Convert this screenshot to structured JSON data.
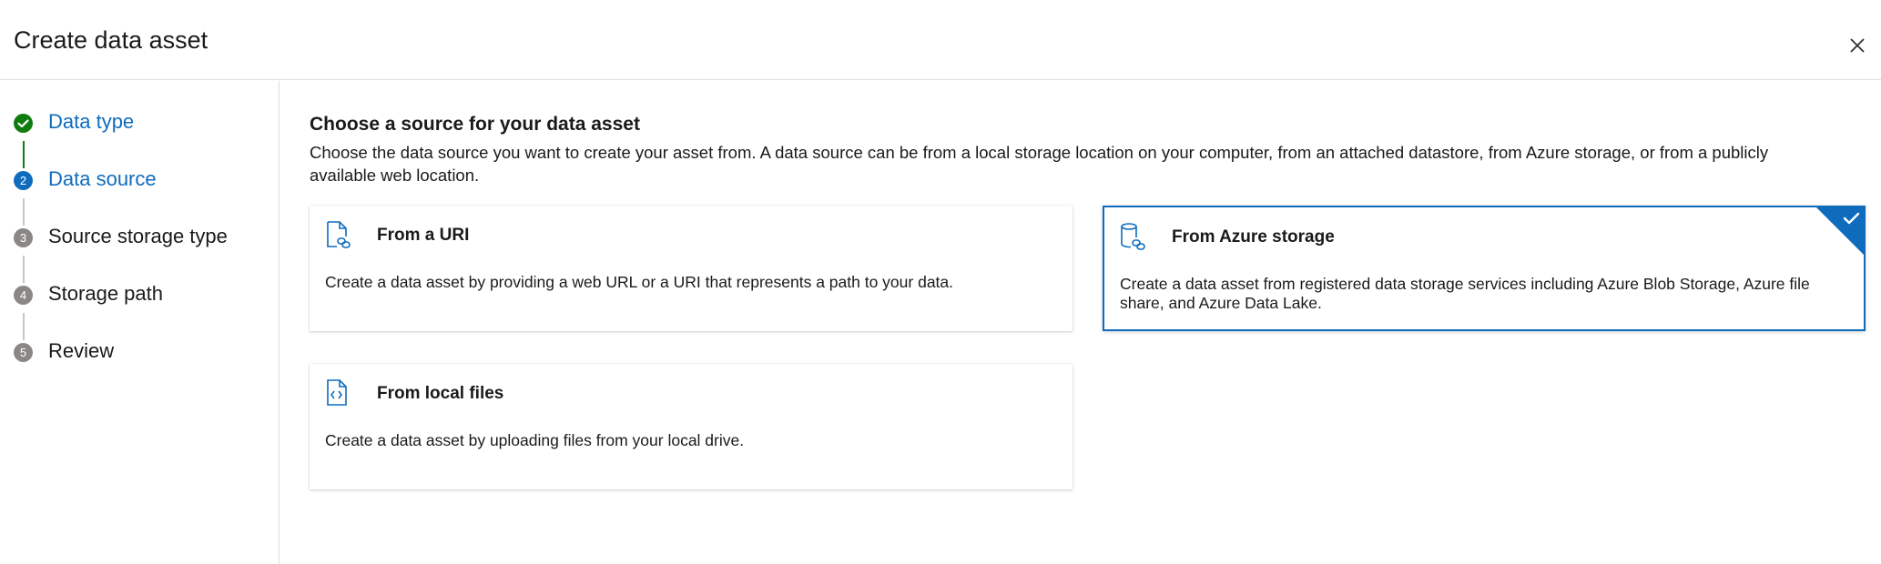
{
  "window": {
    "title": "Create data asset"
  },
  "steps": [
    {
      "label": "Data type",
      "state": "done"
    },
    {
      "label": "Data source",
      "number": "2",
      "state": "current"
    },
    {
      "label": "Source storage type",
      "number": "3",
      "state": "pending"
    },
    {
      "label": "Storage path",
      "number": "4",
      "state": "pending"
    },
    {
      "label": "Review",
      "number": "5",
      "state": "pending"
    }
  ],
  "main": {
    "heading": "Choose a source for your data asset",
    "description": "Choose the data source you want to create your asset from. A data source can be from a local storage location on your computer, from an attached datastore, from Azure storage, or from a publicly available web location.",
    "options": [
      {
        "title": "From a URI",
        "description": "Create a data asset by providing a web URL or a URI that represents a path to your data.",
        "icon": "file-link-icon",
        "selected": false
      },
      {
        "title": "From Azure storage",
        "description": "Create a data asset from registered data storage services including Azure Blob Storage, Azure file share, and Azure Data Lake.",
        "icon": "database-link-icon",
        "selected": true
      },
      {
        "title": "From local files",
        "description": "Create a data asset by uploading files from your local drive.",
        "icon": "file-code-icon",
        "selected": false
      }
    ]
  },
  "colors": {
    "accent": "#0f6cbd",
    "success": "#107c10",
    "pending": "#8a8886",
    "border": "#e1dfdd"
  }
}
